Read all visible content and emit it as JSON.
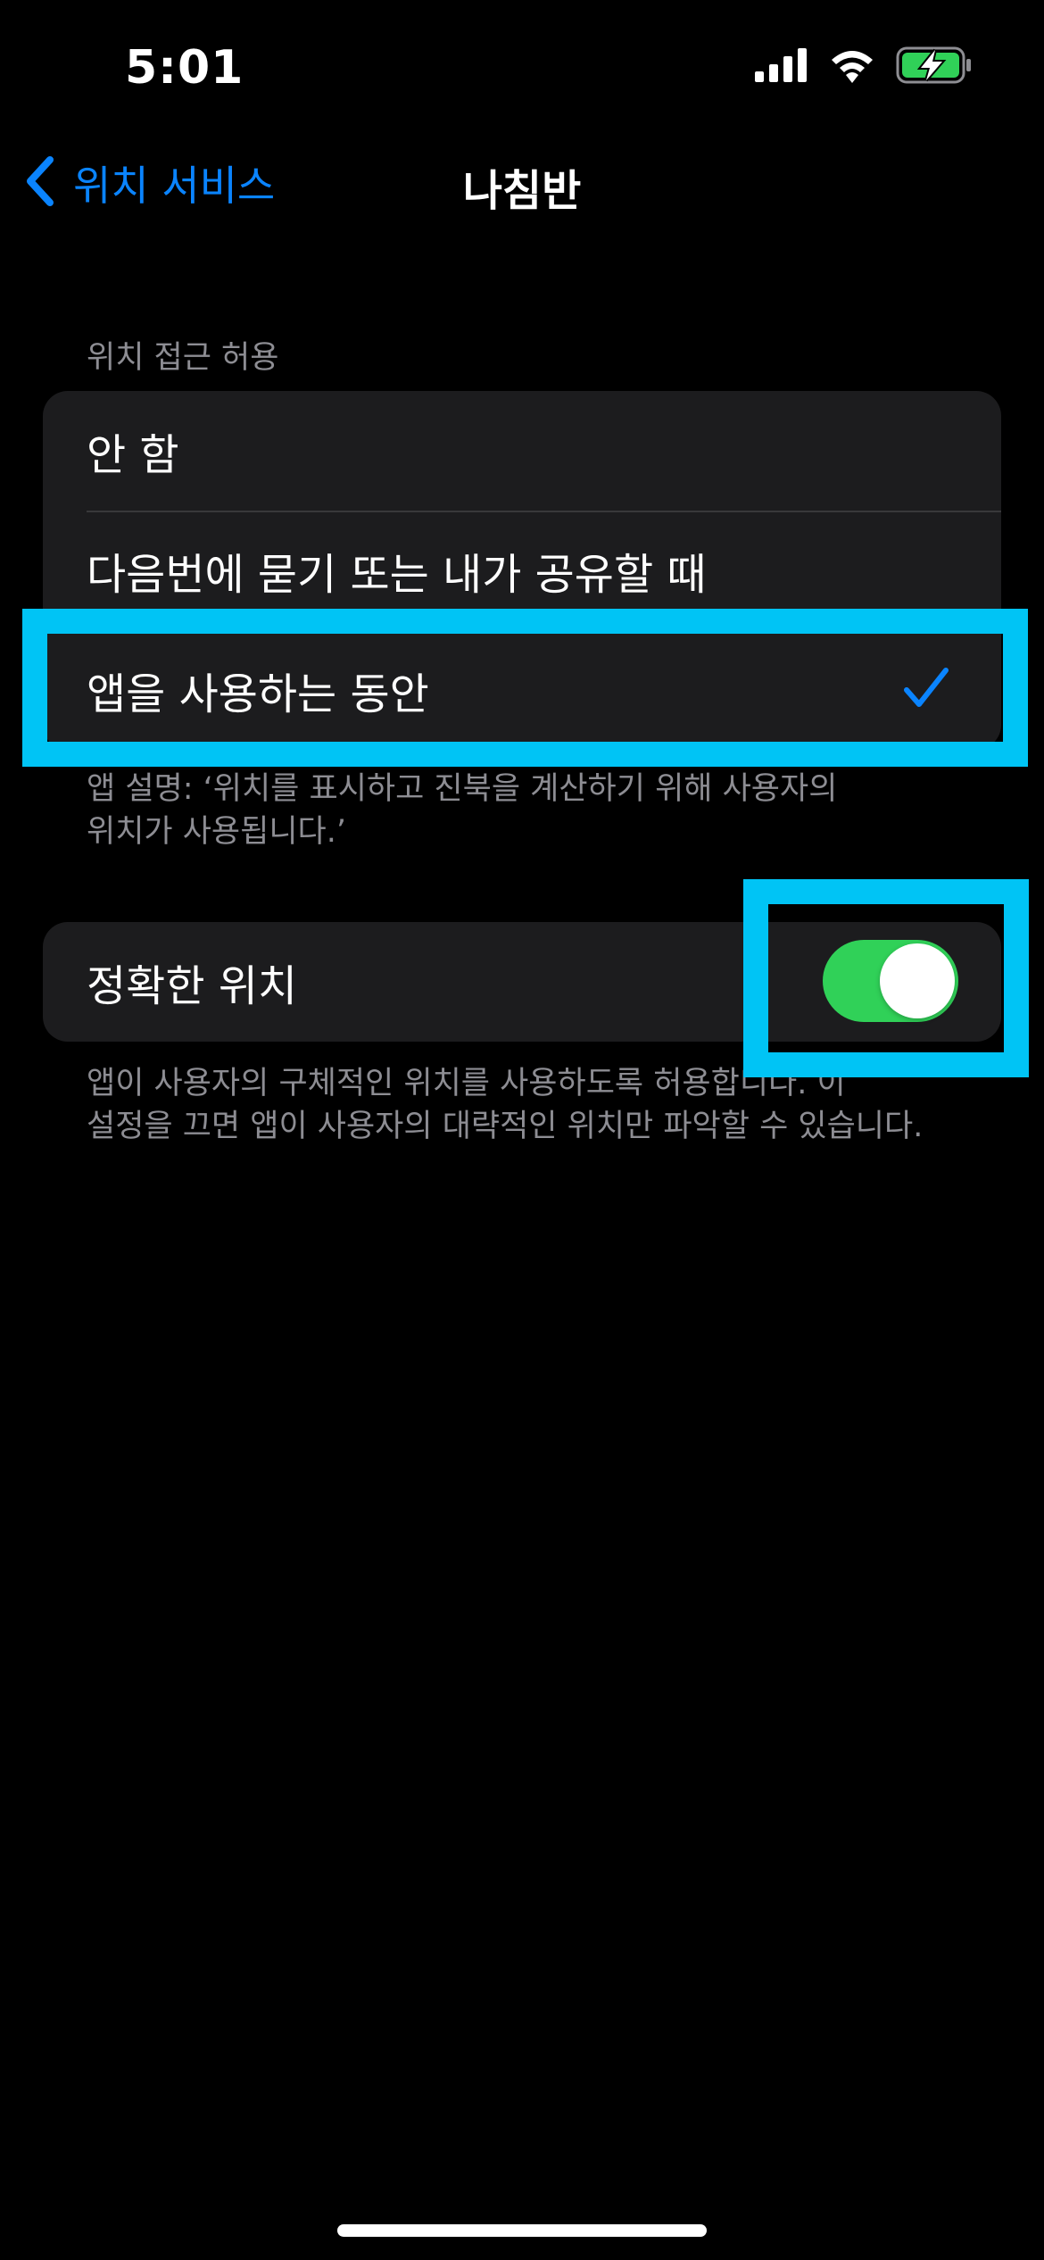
{
  "status_bar": {
    "time": "5:01",
    "icons": [
      "cellular-signal-icon",
      "wifi-icon",
      "battery-charging-icon"
    ],
    "battery_color": "#30d158"
  },
  "nav": {
    "back_label": "위치 서비스",
    "title": "나침반",
    "accent_color": "#0a84ff"
  },
  "location_access": {
    "header": "위치 접근 허용",
    "options": [
      {
        "label": "안 함",
        "selected": false
      },
      {
        "label": "다음번에 묻기 또는 내가 공유할 때",
        "selected": false
      },
      {
        "label": "앱을 사용하는 동안",
        "selected": true
      }
    ],
    "footer_line1": "앱 설명: ‘위치를 표시하고 진북을 계산하기 위해 사용자의",
    "footer_line2": "위치가 사용됩니다.’"
  },
  "precise_location": {
    "label": "정확한 위치",
    "enabled": true,
    "toggle_color": "#30d158",
    "footer_line1": "앱이 사용자의 구체적인 위치를 사용하도록 허용합니다. 이",
    "footer_line2": "설정을 끄면 앱이 사용자의 대략적인 위치만 파악할 수 있습니다."
  },
  "highlight_color": "#00c4f5"
}
